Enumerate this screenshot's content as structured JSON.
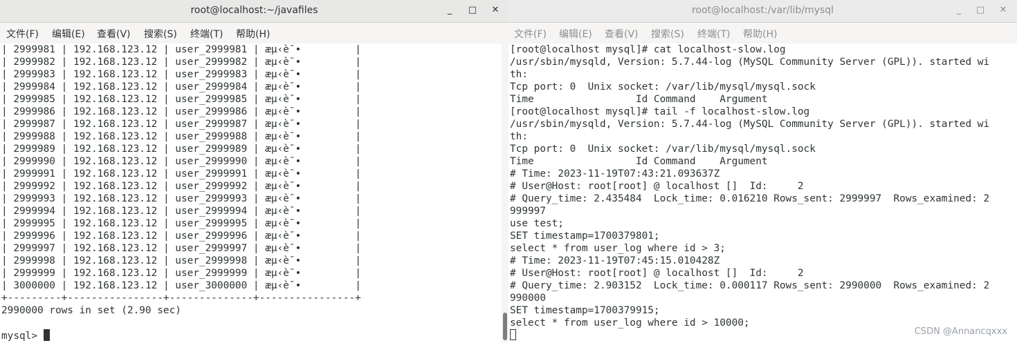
{
  "left_window": {
    "title": "root@localhost:~/javafiles",
    "controls": [
      "_",
      "□",
      "✕"
    ],
    "menu": [
      "文件(F)",
      "编辑(E)",
      "查看(V)",
      "搜索(S)",
      "终端(T)",
      "帮助(H)"
    ],
    "rows": [
      {
        "id": "2999981",
        "ip": "192.168.123.12",
        "user": "user_2999981",
        "extra": "æµ‹è¯•"
      },
      {
        "id": "2999982",
        "ip": "192.168.123.12",
        "user": "user_2999982",
        "extra": "æµ‹è¯•"
      },
      {
        "id": "2999983",
        "ip": "192.168.123.12",
        "user": "user_2999983",
        "extra": "æµ‹è¯•"
      },
      {
        "id": "2999984",
        "ip": "192.168.123.12",
        "user": "user_2999984",
        "extra": "æµ‹è¯•"
      },
      {
        "id": "2999985",
        "ip": "192.168.123.12",
        "user": "user_2999985",
        "extra": "æµ‹è¯•"
      },
      {
        "id": "2999986",
        "ip": "192.168.123.12",
        "user": "user_2999986",
        "extra": "æµ‹è¯•"
      },
      {
        "id": "2999987",
        "ip": "192.168.123.12",
        "user": "user_2999987",
        "extra": "æµ‹è¯•"
      },
      {
        "id": "2999988",
        "ip": "192.168.123.12",
        "user": "user_2999988",
        "extra": "æµ‹è¯•"
      },
      {
        "id": "2999989",
        "ip": "192.168.123.12",
        "user": "user_2999989",
        "extra": "æµ‹è¯•"
      },
      {
        "id": "2999990",
        "ip": "192.168.123.12",
        "user": "user_2999990",
        "extra": "æµ‹è¯•"
      },
      {
        "id": "2999991",
        "ip": "192.168.123.12",
        "user": "user_2999991",
        "extra": "æµ‹è¯•"
      },
      {
        "id": "2999992",
        "ip": "192.168.123.12",
        "user": "user_2999992",
        "extra": "æµ‹è¯•"
      },
      {
        "id": "2999993",
        "ip": "192.168.123.12",
        "user": "user_2999993",
        "extra": "æµ‹è¯•"
      },
      {
        "id": "2999994",
        "ip": "192.168.123.12",
        "user": "user_2999994",
        "extra": "æµ‹è¯•"
      },
      {
        "id": "2999995",
        "ip": "192.168.123.12",
        "user": "user_2999995",
        "extra": "æµ‹è¯•"
      },
      {
        "id": "2999996",
        "ip": "192.168.123.12",
        "user": "user_2999996",
        "extra": "æµ‹è¯•"
      },
      {
        "id": "2999997",
        "ip": "192.168.123.12",
        "user": "user_2999997",
        "extra": "æµ‹è¯•"
      },
      {
        "id": "2999998",
        "ip": "192.168.123.12",
        "user": "user_2999998",
        "extra": "æµ‹è¯•"
      },
      {
        "id": "2999999",
        "ip": "192.168.123.12",
        "user": "user_2999999",
        "extra": "æµ‹è¯•"
      },
      {
        "id": "3000000",
        "ip": "192.168.123.12",
        "user": "user_3000000",
        "extra": "æµ‹è¯•"
      }
    ],
    "table_border": "+---------+----------------+--------------+----------------+",
    "result": "2990000 rows in set (2.90 sec)",
    "prompt": "mysql> "
  },
  "right_window": {
    "title": "root@localhost:/var/lib/mysql",
    "controls": [
      "_",
      "□",
      "✕"
    ],
    "menu": [
      "文件(F)",
      "编辑(E)",
      "查看(V)",
      "搜索(S)",
      "终端(T)",
      "帮助(H)"
    ],
    "lines": [
      "[root@localhost mysql]# cat localhost-slow.log",
      "/usr/sbin/mysqld, Version: 5.7.44-log (MySQL Community Server (GPL)). started wi",
      "th:",
      "Tcp port: 0  Unix socket: /var/lib/mysql/mysql.sock",
      "Time                 Id Command    Argument",
      "[root@localhost mysql]# tail -f localhost-slow.log",
      "/usr/sbin/mysqld, Version: 5.7.44-log (MySQL Community Server (GPL)). started wi",
      "th:",
      "Tcp port: 0  Unix socket: /var/lib/mysql/mysql.sock",
      "Time                 Id Command    Argument",
      "# Time: 2023-11-19T07:43:21.093637Z",
      "# User@Host: root[root] @ localhost []  Id:     2",
      "# Query_time: 2.435484  Lock_time: 0.016210 Rows_sent: 2999997  Rows_examined: 2",
      "999997",
      "use test;",
      "SET timestamp=1700379801;",
      "select * from user_log where id > 3;",
      "# Time: 2023-11-19T07:45:15.010428Z",
      "# User@Host: root[root] @ localhost []  Id:     2",
      "# Query_time: 2.903152  Lock_time: 0.000117 Rows_sent: 2990000  Rows_examined: 2",
      "990000",
      "SET timestamp=1700379915;",
      "select * from user_log where id > 10000;"
    ]
  },
  "watermark": "CSDN @Annancqxxx"
}
